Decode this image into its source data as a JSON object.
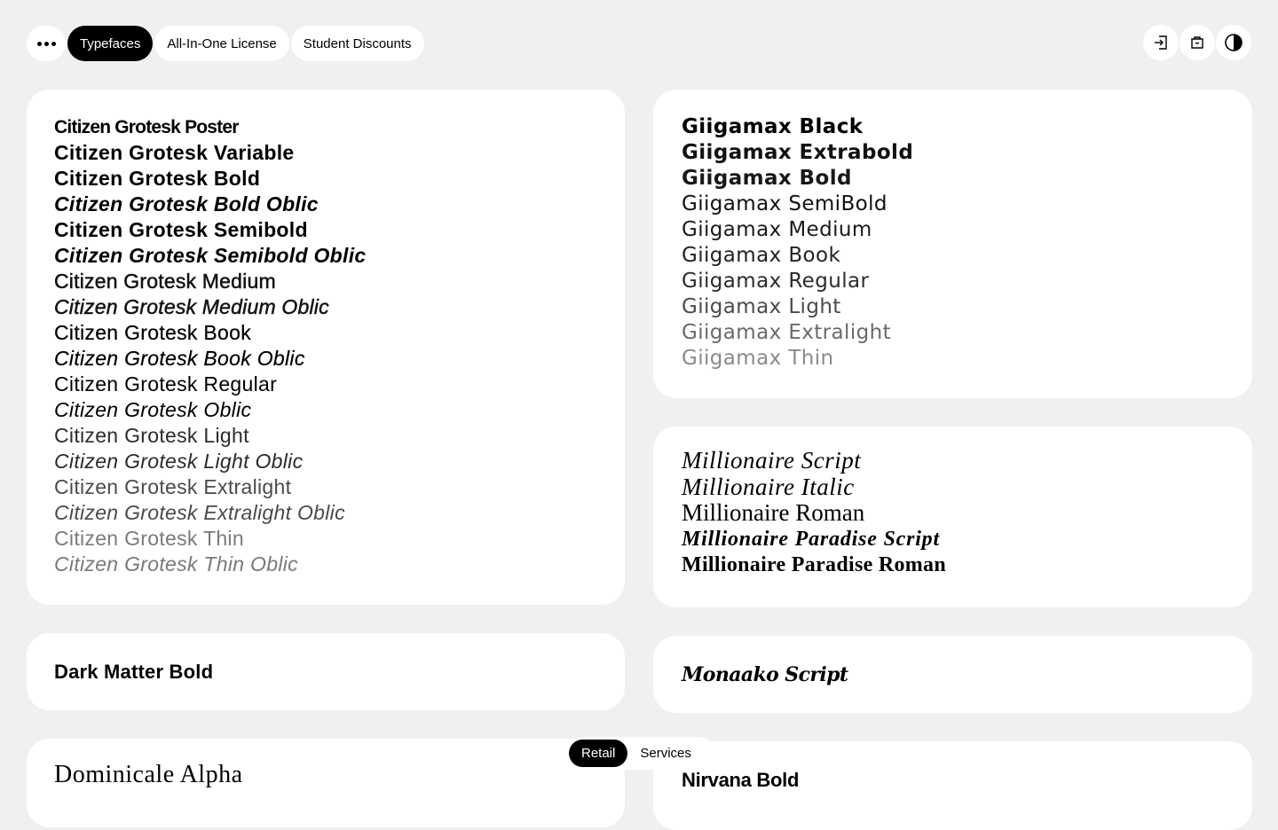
{
  "nav": {
    "menu_icon": "more-dots-icon",
    "tabs": [
      {
        "label": "Typefaces",
        "active": true
      },
      {
        "label": "All-In-One License",
        "active": false
      },
      {
        "label": "Student Discounts",
        "active": false
      }
    ],
    "actions": [
      {
        "icon": "login-icon"
      },
      {
        "icon": "shopping-bag-icon"
      },
      {
        "icon": "contrast-toggle-icon"
      }
    ]
  },
  "families": {
    "citizen_grotesk": [
      "Citizen Grotesk Poster",
      "Citizen Grotesk Variable",
      "Citizen Grotesk Bold",
      "Citizen Grotesk Bold Oblic",
      "Citizen Grotesk Semibold",
      "Citizen Grotesk Semibold Oblic",
      "Citizen Grotesk Medium",
      "Citizen Grotesk Medium Oblic",
      "Citizen Grotesk Book",
      "Citizen Grotesk Book Oblic",
      "Citizen Grotesk Regular",
      "Citizen Grotesk Oblic",
      "Citizen Grotesk Light",
      "Citizen Grotesk Light Oblic",
      "Citizen Grotesk Extralight",
      "Citizen Grotesk Extralight Oblic",
      "Citizen Grotesk Thin",
      "Citizen Grotesk Thin Oblic"
    ],
    "giigamax": [
      "Giigamax Black",
      "Giigamax Extrabold",
      "Giigamax Bold",
      "Giigamax SemiBold",
      "Giigamax Medium",
      "Giigamax Book",
      "Giigamax Regular",
      "Giigamax Light",
      "Giigamax Extralight",
      "Giigamax Thin"
    ],
    "millionaire": [
      "Millionaire Script",
      "Millionaire Italic",
      "Millionaire Roman",
      "Millionaire Paradise Script",
      "Millionaire Paradise Roman"
    ],
    "dark_matter": "Dark Matter Bold",
    "monaako": "Monaako Script",
    "dominicale": "Dominicale Alpha",
    "nirvana": "Nirvana Bold"
  },
  "segment": {
    "options": [
      "Retail",
      "Services"
    ],
    "selected": "Retail"
  }
}
